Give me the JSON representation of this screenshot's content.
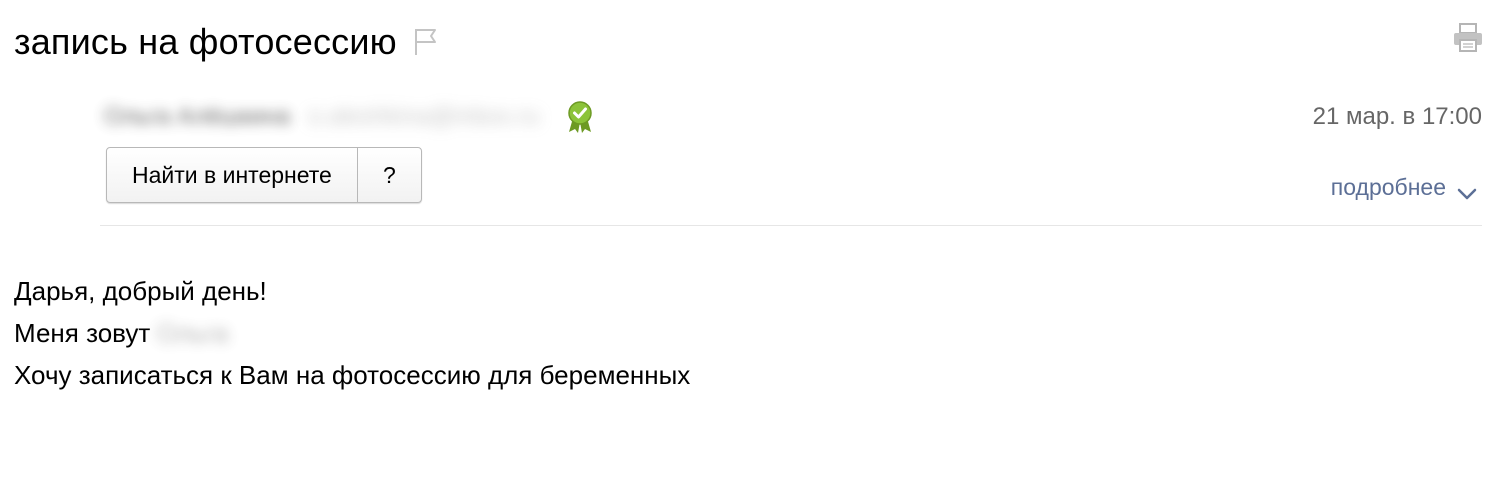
{
  "message": {
    "subject": "запись на фотосессию",
    "date": "21 мар. в 17:00",
    "more_label": "подробнее"
  },
  "sender": {
    "name": "Ольга Алёшкина",
    "email": "o.aleshkina@inbox.ru",
    "verified_icon": "verified-ribbon-icon"
  },
  "actions": {
    "search_web_label": "Найти в интернете",
    "help_label": "?"
  },
  "body": {
    "line1": "Дарья, добрый день!",
    "line2_prefix": "Меня зовут",
    "line2_name": "Ольга",
    "line3": "Хочу записаться к Вам на фотосессию для беременных"
  },
  "colors": {
    "link": "#5c6f96",
    "date": "#666666",
    "verified_green": "#7fae2a",
    "icon_gray": "#bdbdbd"
  }
}
